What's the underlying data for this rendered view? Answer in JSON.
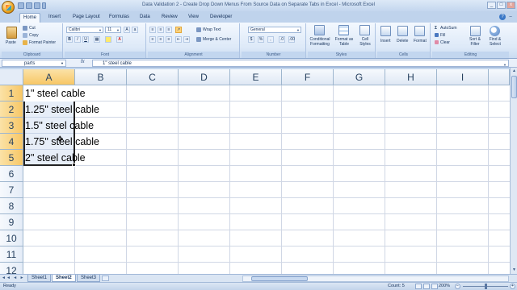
{
  "window": {
    "title": "Data Validation 2 - Create Drop Down Menus From Source Data on Separate Tabs in Excel - Microsoft Excel"
  },
  "ribbon_tabs": [
    "Home",
    "Insert",
    "Page Layout",
    "Formulas",
    "Data",
    "Review",
    "View",
    "Developer"
  ],
  "clipboard": {
    "paste": "Paste",
    "cut": "Cut",
    "copy": "Copy",
    "format_painter": "Format Painter",
    "label": "Clipboard"
  },
  "font": {
    "name": "Calibri",
    "size": "11",
    "bold": "B",
    "italic": "I",
    "underline": "U",
    "label": "Font"
  },
  "alignment": {
    "wrap_text": "Wrap Text",
    "merge_center": "Merge & Center",
    "label": "Alignment"
  },
  "number": {
    "format": "General",
    "currency": "$",
    "percent": "%",
    "comma": ",",
    "label": "Number"
  },
  "styles": {
    "conditional": "Conditional Formatting",
    "format_table": "Format as Table",
    "cell_styles": "Cell Styles",
    "label": "Styles"
  },
  "cells": {
    "insert": "Insert",
    "delete": "Delete",
    "format": "Format",
    "label": "Cells"
  },
  "editing": {
    "autosum": "AutoSum",
    "fill": "Fill",
    "clear": "Clear",
    "sort_filter": "Sort & Filter",
    "find_select": "Find & Select",
    "label": "Editing"
  },
  "formula_bar": {
    "name_box": "parts",
    "fx": "fx",
    "value": "1\" steel cable"
  },
  "columns": [
    "A",
    "B",
    "C",
    "D",
    "E",
    "F",
    "G",
    "H",
    "I"
  ],
  "rows": [
    "1",
    "2",
    "3",
    "4",
    "5",
    "6",
    "7",
    "8",
    "9",
    "10",
    "11",
    "12"
  ],
  "cells_data": [
    "1\" steel cable",
    "1.25\" steel cable",
    "1.5\" steel cable",
    "1.75\" steel cable",
    "2\" steel cable"
  ],
  "sheets": [
    "Sheet1",
    "Sheet2",
    "Sheet3"
  ],
  "status": {
    "ready": "Ready",
    "count": "Count: 5",
    "zoom": "200%",
    "zoom_minus": "−",
    "zoom_plus": "+"
  }
}
